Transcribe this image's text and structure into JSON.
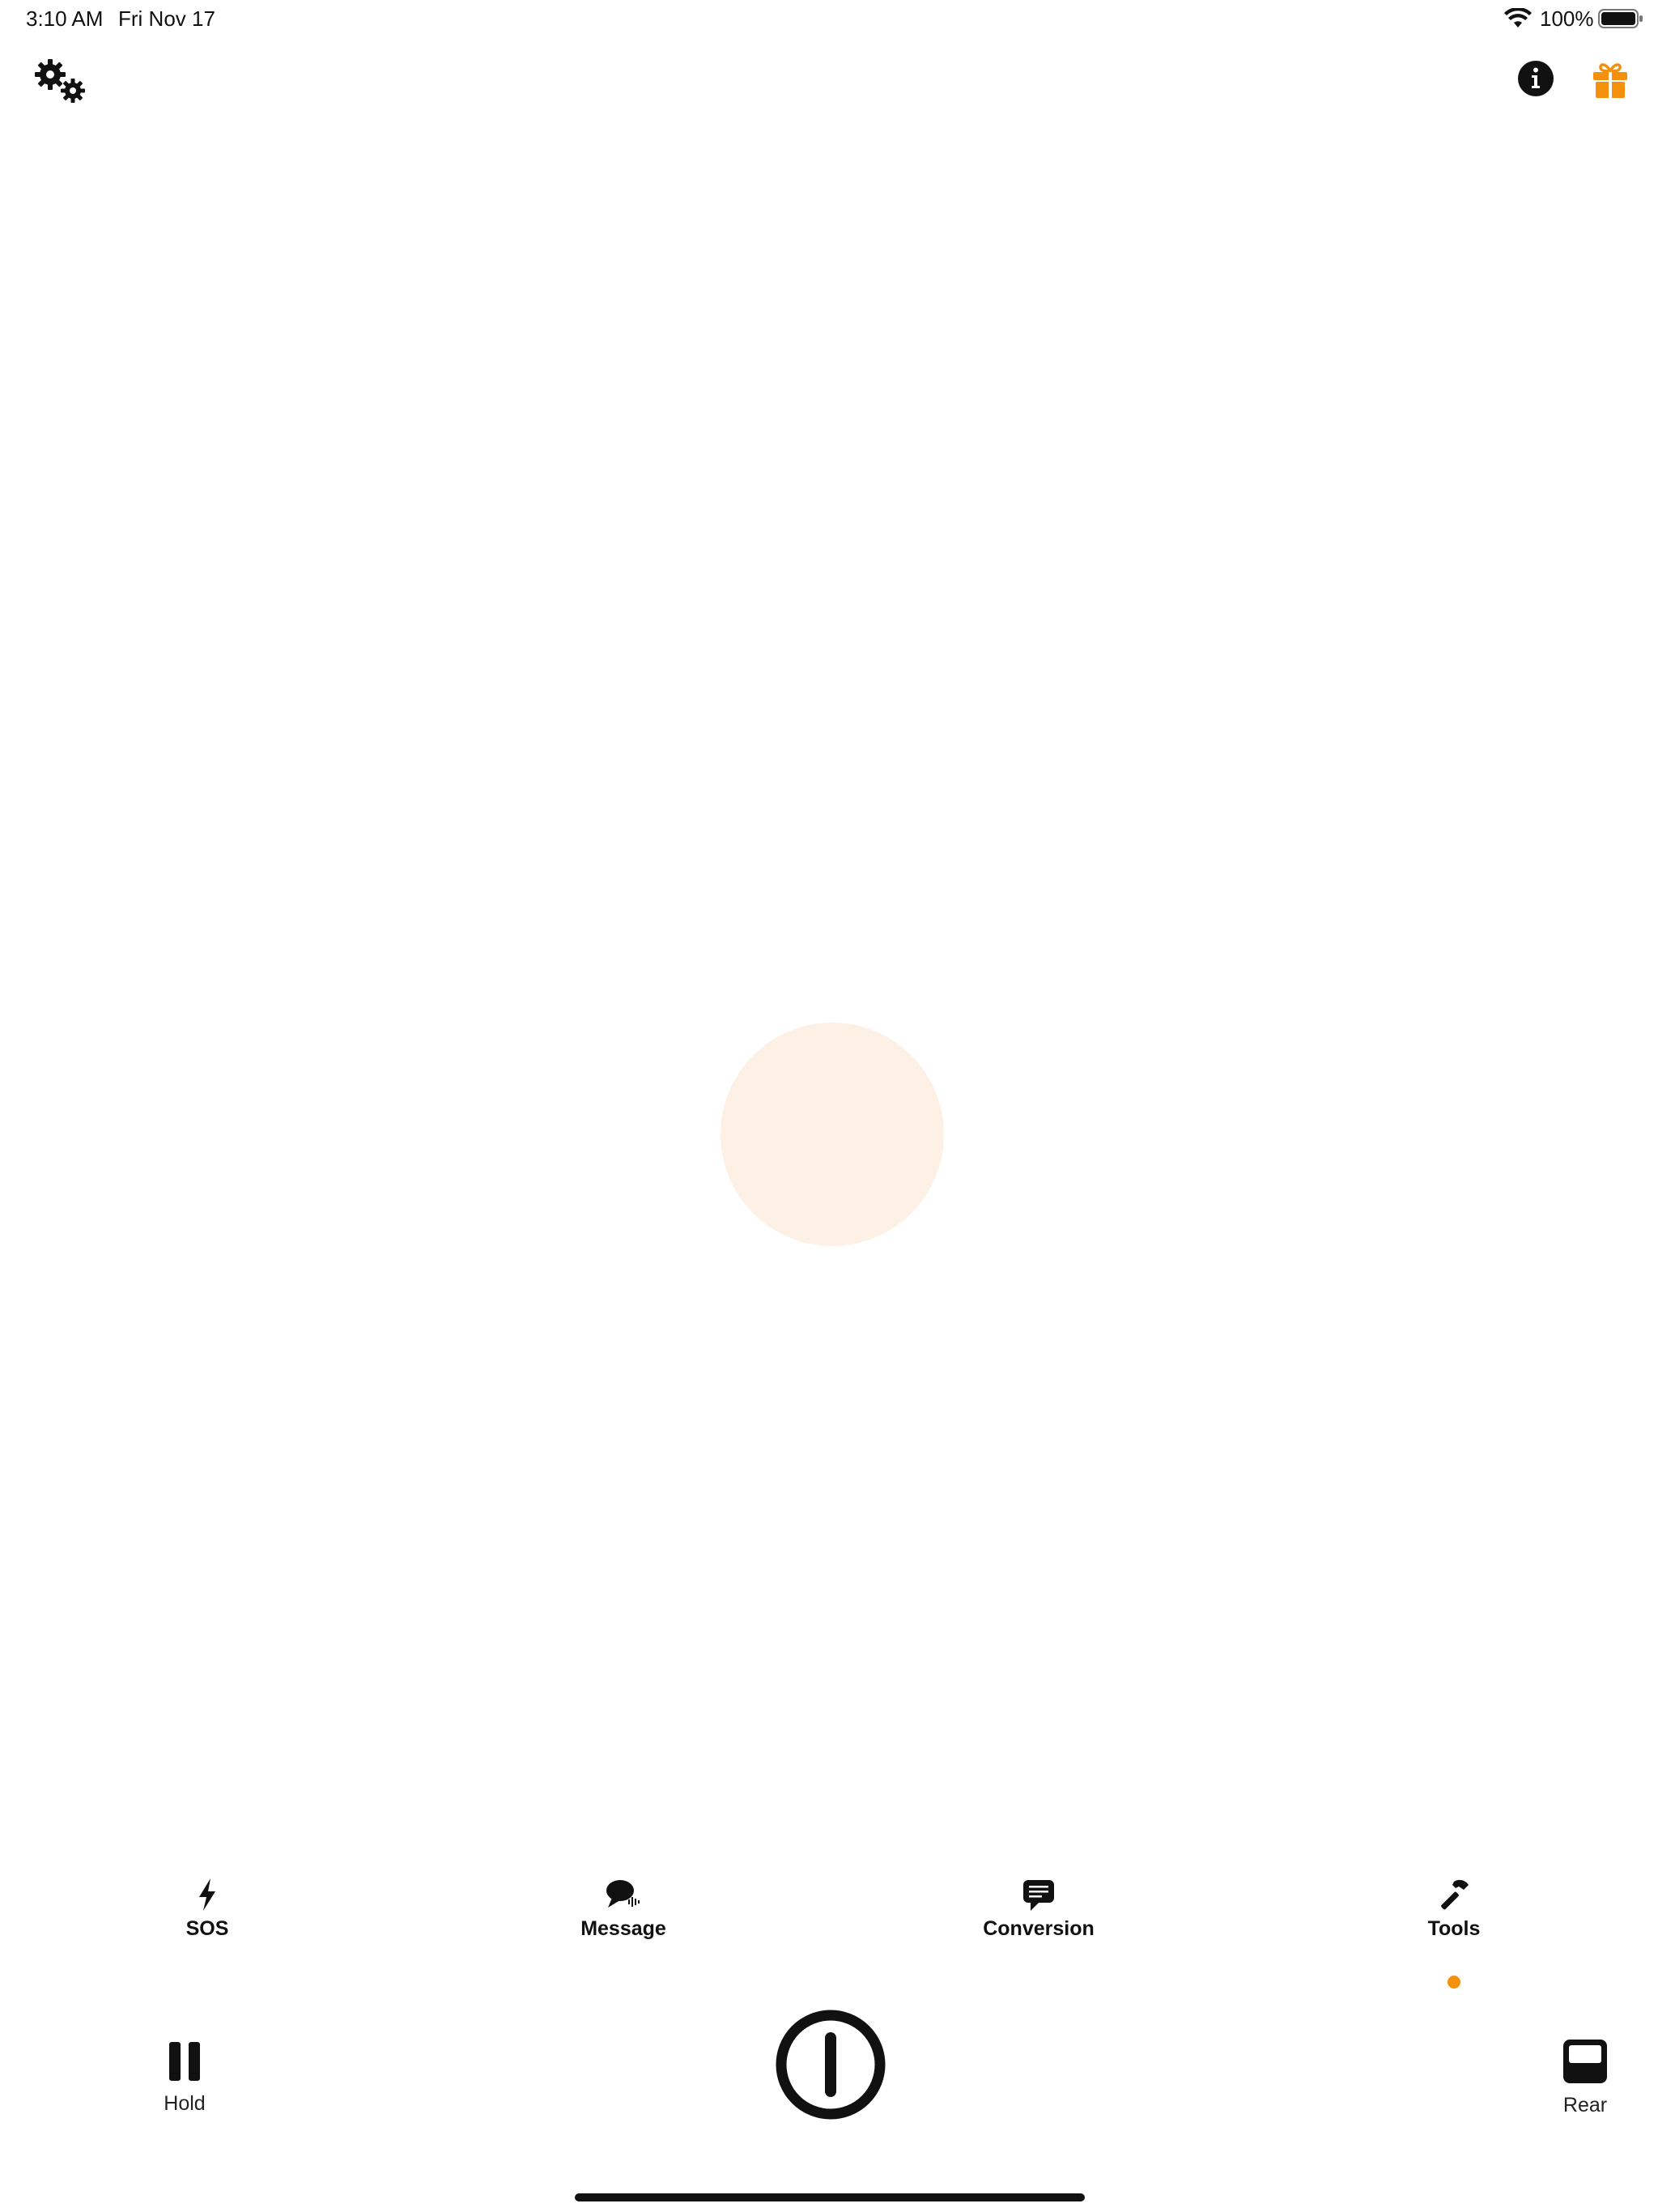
{
  "status_bar": {
    "time": "3:10 AM",
    "date": "Fri Nov 17",
    "battery_percent": "100%",
    "wifi_icon": "wifi-icon",
    "battery_icon": "battery-full-icon"
  },
  "top_bar": {
    "settings_icon": "gears-icon",
    "info_icon": "info-circle-icon",
    "gift_icon": "gift-icon"
  },
  "main": {
    "light_color": "#fdf0e4"
  },
  "tabs": [
    {
      "label": "SOS",
      "icon": "bolt-icon"
    },
    {
      "label": "Message",
      "icon": "speech-bubble-icon"
    },
    {
      "label": "Conversion",
      "icon": "message-lines-icon"
    },
    {
      "label": "Tools",
      "icon": "hammer-icon"
    }
  ],
  "active_tab": "Tools",
  "controls": {
    "hold_label": "Hold",
    "rear_label": "Rear",
    "power_icon": "power-icon"
  },
  "colors": {
    "accent": "#f5900c",
    "text": "#111111",
    "light": "#fdf0e4"
  }
}
